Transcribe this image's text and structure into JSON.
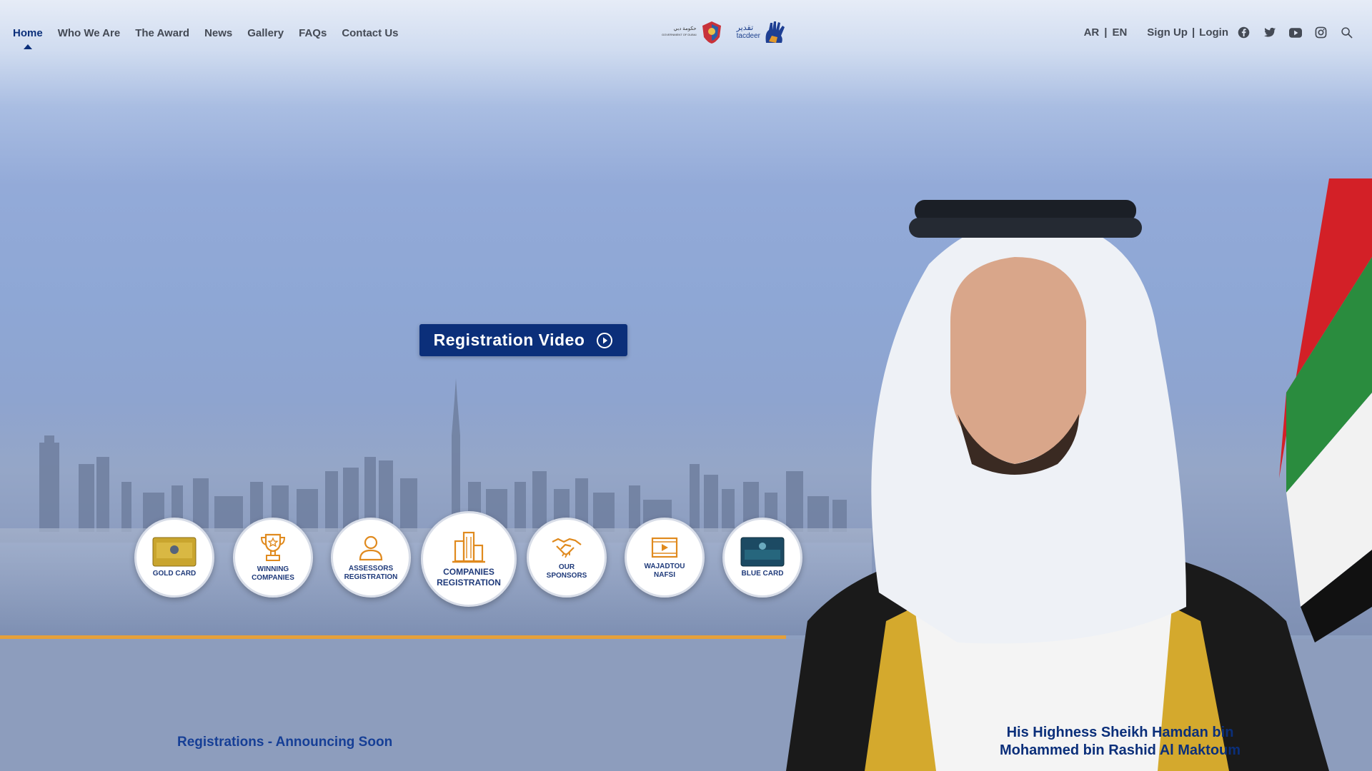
{
  "nav": {
    "items": [
      {
        "label": "Home",
        "active": true
      },
      {
        "label": "Who We Are"
      },
      {
        "label": "The Award"
      },
      {
        "label": "News"
      },
      {
        "label": "Gallery"
      },
      {
        "label": "FAQs"
      },
      {
        "label": "Contact Us"
      }
    ],
    "lang": {
      "ar": "AR",
      "sep": "|",
      "en": "EN"
    },
    "auth": {
      "signup": "Sign Up",
      "sep": "|",
      "login": "Login"
    },
    "social_icons": [
      "facebook-icon",
      "twitter-icon",
      "youtube-icon",
      "instagram-icon",
      "search-icon"
    ]
  },
  "logos": {
    "gov_ar": "حكومة دبي",
    "gov_en": "GOVERNMENT OF DUBAI",
    "tq_ar": "تقدير",
    "tq_en": "tacdeer"
  },
  "hero": {
    "video_label": "Registration Video"
  },
  "circles": [
    {
      "label": "GOLD CARD",
      "icon": "gold-card-icon"
    },
    {
      "label": "WINNING COMPANIES",
      "icon": "trophy-icon"
    },
    {
      "label": "ASSESSORS REGISTRATION",
      "icon": "person-icon"
    },
    {
      "label": "COMPANIES REGISTRATION",
      "icon": "buildings-icon"
    },
    {
      "label": "OUR SPONSORS",
      "icon": "handshake-icon"
    },
    {
      "label": "WAJADTOU NAFSI",
      "icon": "video-icon"
    },
    {
      "label": "BLUE CARD",
      "icon": "blue-card-icon"
    }
  ],
  "announcement": "Registrations - Announcing Soon",
  "caption": {
    "line1": "His Highness Sheikh Hamdan bin",
    "line2": "Mohammed bin Rashid Al Maktoum"
  },
  "colors": {
    "brand": "#0b2f7a",
    "accent": "#e5a03a",
    "icon_orange": "#e08a1e"
  }
}
